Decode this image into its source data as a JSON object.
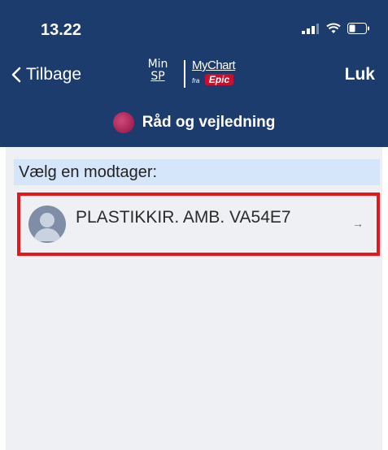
{
  "status_bar": {
    "time": "13.22"
  },
  "nav": {
    "back_label": "Tilbage",
    "close_label": "Luk"
  },
  "logos": {
    "minsp_top": "Min",
    "minsp_bottom": "SP",
    "mychart": "MyChart",
    "fra": "fra",
    "epic": "Epic"
  },
  "subheader": {
    "title": "Råd og vejledning"
  },
  "content": {
    "prompt": "Vælg en modtager:",
    "recipients": [
      {
        "name": "PLASTIKKIR. AMB. VA54E7"
      }
    ]
  },
  "colors": {
    "header_bg": "#1d3c6e",
    "highlight_border": "#e8161b",
    "prompt_bg": "#d6e6fa"
  }
}
